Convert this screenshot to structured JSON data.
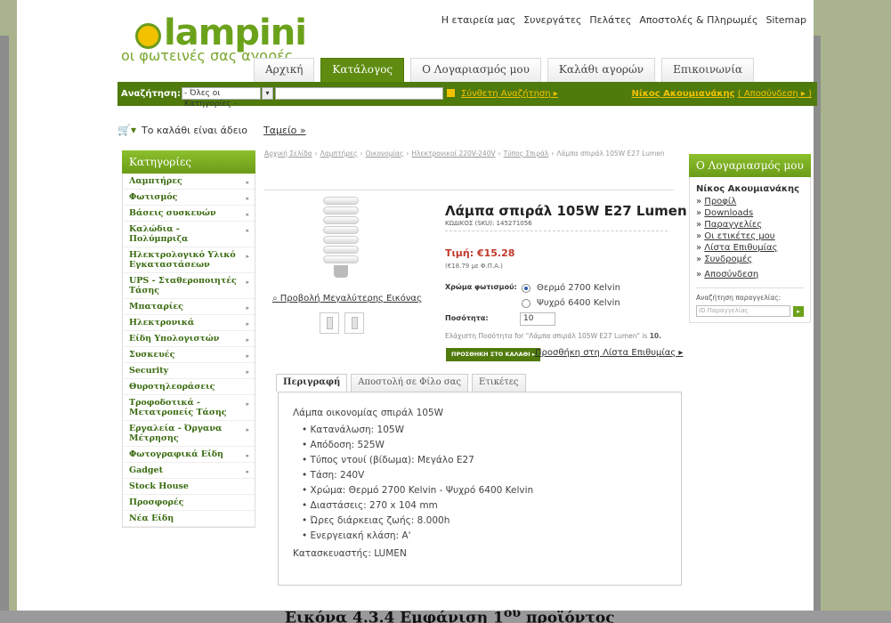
{
  "caption": "Εικόνα 4.3.4 Εμφάνιση 1ου προϊόντος",
  "brand": {
    "logo_text": "lampini",
    "tagline": "οι φωτεινές σας αγορές",
    "accent_color": "#6ba21b",
    "dark_color": "#4f7a0c"
  },
  "top_links": [
    "Η εταιρεία μας",
    "Συνεργάτες",
    "Πελάτες",
    "Αποστολές & Πληρωμές",
    "Sitemap"
  ],
  "main_nav": [
    {
      "label": "Αρχική",
      "active": false
    },
    {
      "label": "Κατάλογος",
      "active": true
    },
    {
      "label": "Ο Λογαριασμός μου",
      "active": false
    },
    {
      "label": "Καλάθι αγορών",
      "active": false
    },
    {
      "label": "Επικοινωνία",
      "active": false
    }
  ],
  "search": {
    "label": "Αναζήτηση:",
    "category_value": "- Όλες οι Κατηγορίες -",
    "query_value": "",
    "advanced_link": "Σύνθετη Αναζήτηση ▸",
    "user_name": "Νίκος Ακουμιανάκης",
    "logout_link": "( Αποσύνδεση ▸ )"
  },
  "cart": {
    "status": "Το καλάθι είναι άδειο",
    "checkout_link": "Ταμείο »"
  },
  "categories": {
    "heading": "Κατηγορίες",
    "items": [
      {
        "label": "Λαμπτήρες",
        "arrow": true
      },
      {
        "label": "Φωτισμός",
        "arrow": true
      },
      {
        "label": "Βάσεις συσκευών",
        "arrow": true
      },
      {
        "label": "Καλώδια - Πολύμπριζα",
        "arrow": true
      },
      {
        "label": "Ηλεκτρολογικό Υλικό Εγκαταστάσεων",
        "arrow": true
      },
      {
        "label": "UPS - Σταθεροποιητές Τάσης",
        "arrow": true
      },
      {
        "label": "Μπαταρίες",
        "arrow": true
      },
      {
        "label": "Ηλεκτρονικά",
        "arrow": true
      },
      {
        "label": "Είδη Υπολογιστών",
        "arrow": true
      },
      {
        "label": "Συσκευές",
        "arrow": true
      },
      {
        "label": "Security",
        "arrow": true
      },
      {
        "label": "Θυροτηλεοράσεις",
        "arrow": false
      },
      {
        "label": "Τροφοδοτικά - Μετατροπείς Τάσης",
        "arrow": true
      },
      {
        "label": "Εργαλεία - Όργανα Μέτρησης",
        "arrow": true
      },
      {
        "label": "Φωτογραφικά Είδη",
        "arrow": true
      },
      {
        "label": "Gadget",
        "arrow": true
      },
      {
        "label": "Stock House",
        "arrow": false
      },
      {
        "label": "Προσφορές",
        "arrow": false
      },
      {
        "label": "Νέα Είδη",
        "arrow": false
      }
    ]
  },
  "breadcrumb": [
    "Αρχική Σελίδα",
    "Λαμπτήρες",
    "Οικονομίας",
    "Ηλεκτρονικοί 220V-240V",
    "Τύπος Σπιράλ",
    "Λάμπα σπιράλ 105W E27 Lumen"
  ],
  "product": {
    "title": "Λάμπα σπιράλ 105W E27 Lumen",
    "sku": "ΚΩΔΙΚΟΣ (SKU): 145271056",
    "enlarge_link": "Προβολή Μεγαλύτερης Εικόνας",
    "price": "Τιμή: €15.28",
    "price_vat": "(€18.79 με Φ.Π.Α.)",
    "color_label": "Χρώμα φωτισμού:",
    "color_options": [
      "Θερμό 2700 Kelvin",
      "Ψυχρό 6400 Kelvin"
    ],
    "selected_color": 0,
    "qty_label": "Ποσότητα:",
    "qty_value": "10",
    "min_qty_prefix": "Ελάχιστη Ποσότητα for \"Λάμπα σπιράλ 105W E27 Lumen\" is ",
    "min_qty_value": "10.",
    "add_to_cart": "ΠΡΟΣΘΗΚΗ ΣΤΟ ΚΑΛΑΘΙ ▸",
    "wishlist_link": "Προσθήκη στη Λίστα Επιθυμίας ▸"
  },
  "account": {
    "heading": "Ο Λογαριασμός μου",
    "name": "Νίκος Ακουμιανάκης",
    "links": [
      "Προφίλ",
      "Downloads",
      "Παραγγελίες",
      "Οι ετικέτες μου",
      "Λίστα Επιθυμίας",
      "Συνδρομές",
      "Αποσύνδεση"
    ],
    "order_search_label": "Αναζήτηση παραγγελίας:",
    "order_search_placeholder": "ID Παραγγελίας"
  },
  "tabs": [
    {
      "label": "Περιγραφή",
      "active": true
    },
    {
      "label": "Αποστολή σε Φίλο σας",
      "active": false
    },
    {
      "label": "Ετικέτες",
      "active": false
    }
  ],
  "description": {
    "intro": "Λάμπα οικονομίας σπιράλ 105W",
    "specs": [
      "Κατανάλωση: 105W",
      "Απόδοση: 525W",
      "Τύπος ντουί (βίδωμα): Μεγάλο Ε27",
      "Τάση: 240V",
      "Χρώμα: Θερμό 2700 Kelvin - Ψυχρό 6400 Kelvin",
      "Διαστάσεις: 270 x 104 mm",
      "Ώρες διάρκειας ζωής: 8.000h",
      "Ενεργειακή κλάση: Α'"
    ],
    "maker": "Κατασκευαστής: LUMEN"
  }
}
